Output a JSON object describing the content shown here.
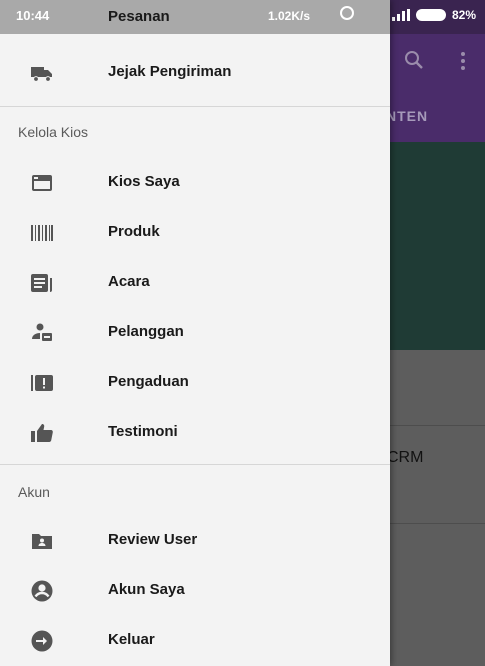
{
  "status_bar": {
    "time": "10:44",
    "title": "Pesanan",
    "speed": "1.02K/s",
    "battery": "82%"
  },
  "background": {
    "tab_label": "NTEN",
    "list_text": "CRM"
  },
  "drawer": {
    "top_items": [
      {
        "label": "Jejak Pengiriman",
        "icon": "truck-icon"
      }
    ],
    "sections": [
      {
        "header": "Kelola Kios",
        "items": [
          {
            "label": "Kios Saya",
            "icon": "store-icon"
          },
          {
            "label": "Produk",
            "icon": "barcode-icon"
          },
          {
            "label": "Acara",
            "icon": "event-icon"
          },
          {
            "label": "Pelanggan",
            "icon": "customer-icon"
          },
          {
            "label": "Pengaduan",
            "icon": "complaint-icon"
          },
          {
            "label": "Testimoni",
            "icon": "thumb-up-icon"
          }
        ]
      },
      {
        "header": "Akun",
        "items": [
          {
            "label": "Review User",
            "icon": "review-user-icon"
          },
          {
            "label": "Akun Saya",
            "icon": "account-circle-icon"
          },
          {
            "label": "Keluar",
            "icon": "logout-icon"
          }
        ]
      }
    ]
  },
  "colors": {
    "drawer_bg": "#f3f3f3",
    "icon": "#555555",
    "toolbar": "#4a2c6a",
    "hero": "#1f3b35"
  }
}
